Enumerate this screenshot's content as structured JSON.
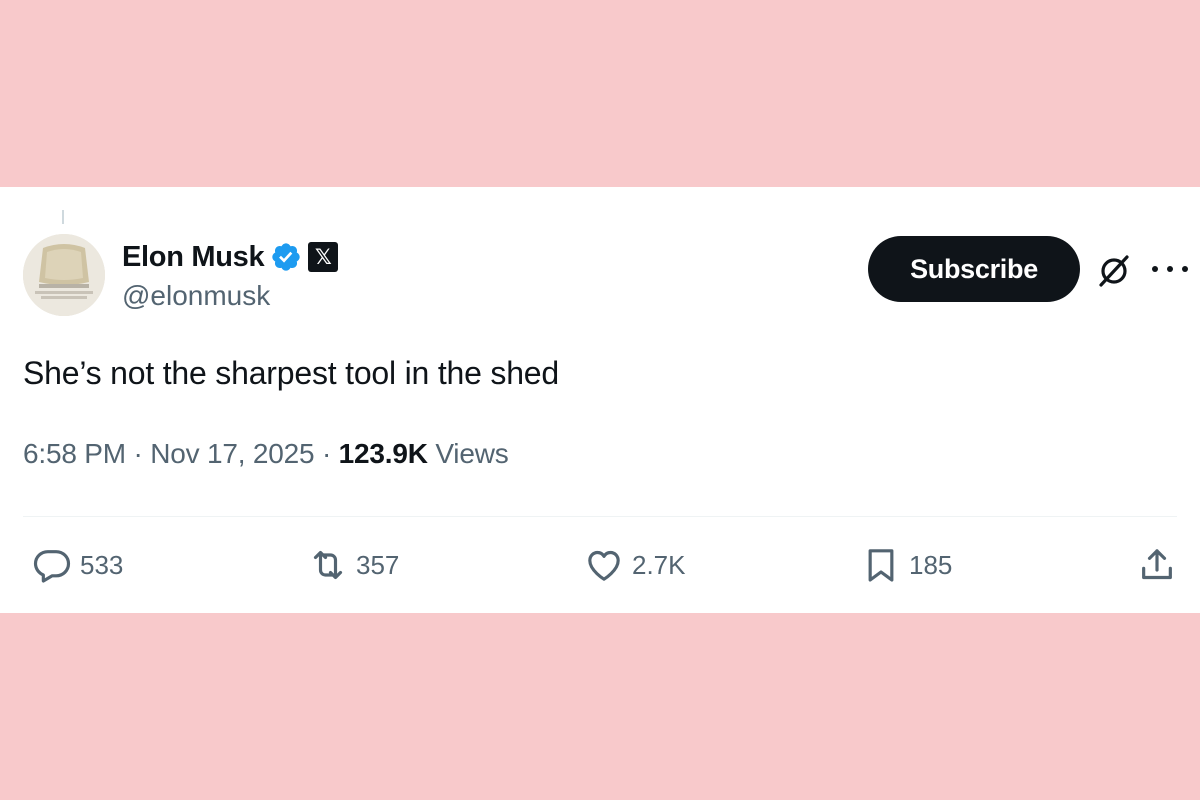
{
  "tweet": {
    "author_name": "Elon Musk",
    "handle": "@elonmusk",
    "affiliation_badge": "𝕏",
    "subscribe_label": "Subscribe",
    "text": "She’s not the sharpest tool in the shed",
    "time": "6:58 PM",
    "separator": " · ",
    "date": "Nov 17, 2025",
    "views_count": "123.9K",
    "views_label": " Views"
  },
  "actions": {
    "replies": "533",
    "reposts": "357",
    "likes": "2.7K",
    "bookmarks": "185"
  },
  "icons": {
    "verified": "verified-badge-icon",
    "affiliation": "x-logo-icon",
    "grok": "grok-icon",
    "more": "more-icon",
    "reply": "reply-icon",
    "repost": "repost-icon",
    "like": "heart-icon",
    "bookmark": "bookmark-icon",
    "share": "share-icon"
  },
  "colors": {
    "background": "#f8c9cb",
    "card": "#ffffff",
    "text_primary": "#0f1419",
    "text_secondary": "#536471",
    "verified_blue": "#1d9bf0",
    "button_dark": "#0f1419"
  }
}
